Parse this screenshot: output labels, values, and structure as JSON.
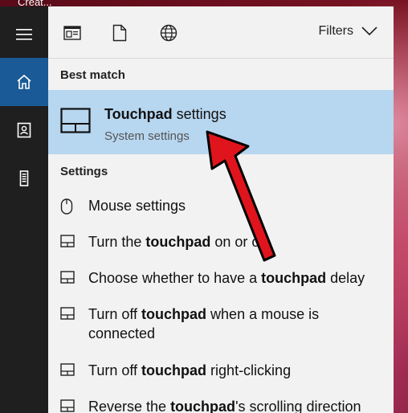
{
  "desktop": {
    "label": "Creat..."
  },
  "rail": {
    "items": [
      {
        "icon": "hamburger-menu-icon"
      },
      {
        "icon": "home-icon"
      },
      {
        "icon": "notebook-icon"
      },
      {
        "icon": "tower-device-icon"
      }
    ]
  },
  "toolbar": {
    "icons": [
      "apps-icon",
      "documents-icon",
      "web-icon"
    ],
    "filters_label": "Filters"
  },
  "best_match": {
    "section_label": "Best match",
    "title_bold": "Touchpad",
    "title_rest": " settings",
    "subtitle": "System settings"
  },
  "settings": {
    "section_label": "Settings",
    "results": [
      {
        "icon": "mouse-icon",
        "pre": "Mouse settings",
        "bold": "",
        "post": ""
      },
      {
        "icon": "touchpad-icon",
        "pre": "Turn the ",
        "bold": "touchpad",
        "post": " on or off"
      },
      {
        "icon": "touchpad-icon",
        "pre": "Choose whether to have a ",
        "bold": "touchpad",
        "post": " delay"
      },
      {
        "icon": "touchpad-icon",
        "pre": "Turn off ",
        "bold": "touchpad",
        "post": " when a mouse is connected"
      },
      {
        "icon": "touchpad-icon",
        "pre": "Turn off ",
        "bold": "touchpad",
        "post": " right-clicking"
      },
      {
        "icon": "touchpad-icon",
        "pre": "Reverse the ",
        "bold": "touchpad",
        "post": "'s scrolling direction"
      }
    ]
  },
  "colors": {
    "accent": "#1a5a96",
    "highlight": "#b7d6ef",
    "annotation_arrow": "#e0141c"
  }
}
